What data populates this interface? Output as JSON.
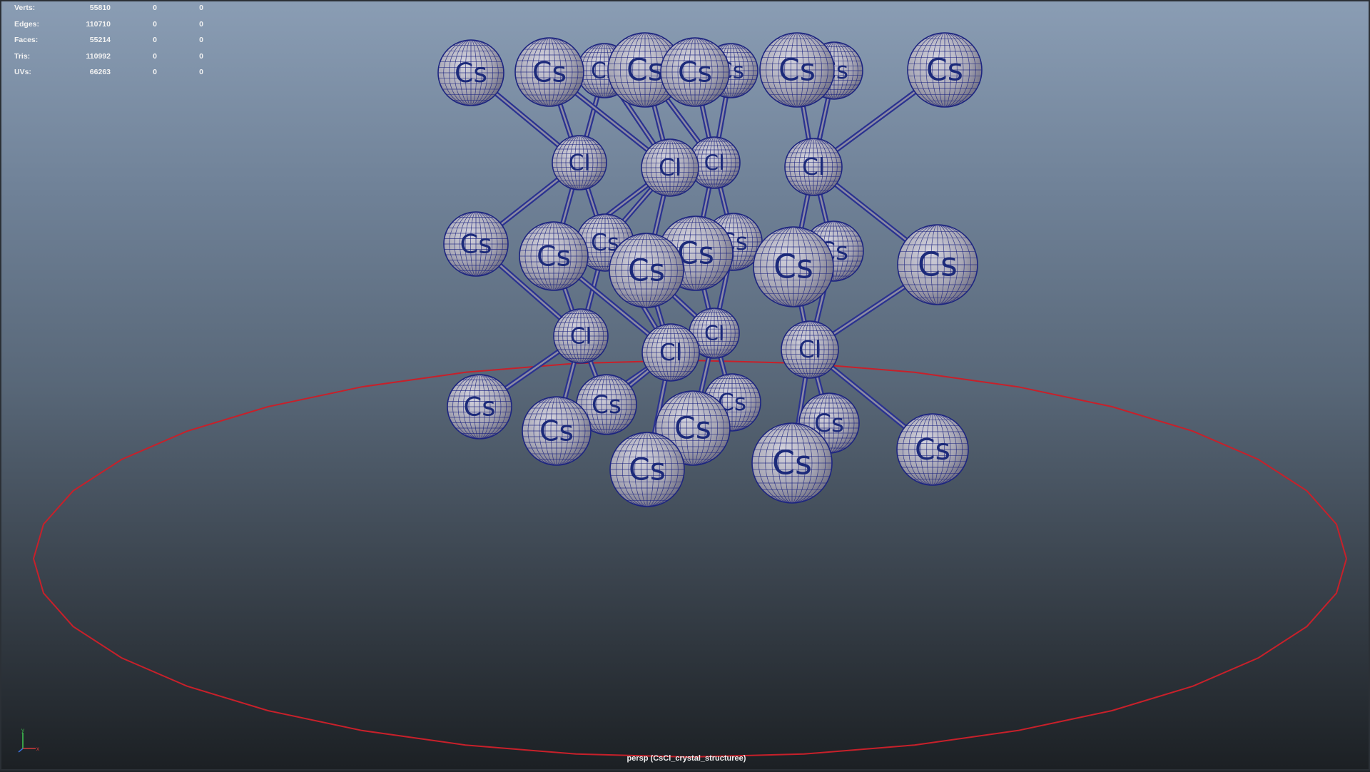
{
  "hud": {
    "rows": [
      {
        "label": "Verts:",
        "v1": "55810",
        "v2": "0",
        "v3": "0"
      },
      {
        "label": "Edges:",
        "v1": "110710",
        "v2": "0",
        "v3": "0"
      },
      {
        "label": "Faces:",
        "v1": "55214",
        "v2": "0",
        "v3": "0"
      },
      {
        "label": "Tris:",
        "v1": "110992",
        "v2": "0",
        "v3": "0"
      },
      {
        "label": "UVs:",
        "v1": "66263",
        "v2": "0",
        "v3": "0"
      }
    ]
  },
  "camera_label": "persp (CsCl_crystal_structuree)",
  "atoms": {
    "cs_label": "Cs",
    "cl_label": "Cl"
  },
  "axis": {
    "y": "y",
    "x": "x"
  },
  "colors": {
    "sphere_fill": "#a9a8b6",
    "wire": "#1d2580",
    "bond": "#2a3290",
    "curve": "#c8202a"
  }
}
